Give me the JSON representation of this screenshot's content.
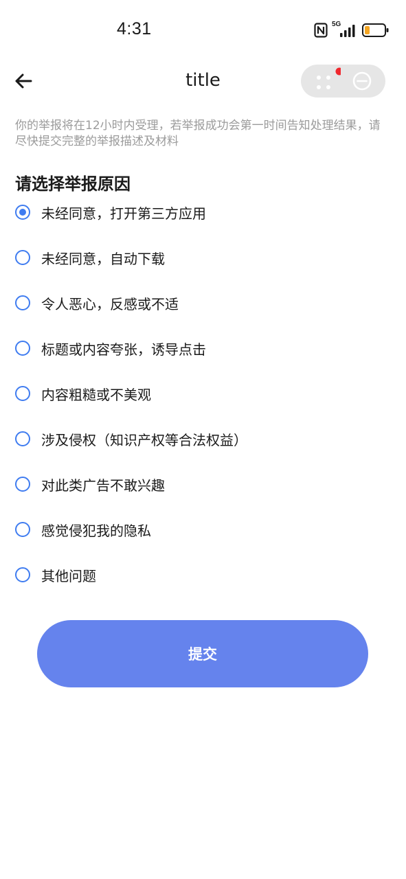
{
  "status_bar": {
    "time": "4:31",
    "network": "5G",
    "battery_color": "#f5a623"
  },
  "header": {
    "title": "title",
    "back_icon": "arrow-left-icon",
    "capsule": {
      "more_icon": "more-dots-icon",
      "close_icon": "minus-circle-icon",
      "badge_color": "#f0272d"
    }
  },
  "notice": "你的举报将在12小时内受理，若举报成功会第一时间告知处理结果，请尽快提交完整的举报描述及材料",
  "section_title": "请选择举报原因",
  "options": [
    {
      "label": "未经同意，打开第三方应用",
      "selected": true
    },
    {
      "label": "未经同意，自动下载",
      "selected": false
    },
    {
      "label": "令人恶心，反感或不适",
      "selected": false
    },
    {
      "label": "标题或内容夸张，诱导点击",
      "selected": false
    },
    {
      "label": "内容粗糙或不美观",
      "selected": false
    },
    {
      "label": "涉及侵权（知识产权等合法权益）",
      "selected": false
    },
    {
      "label": "对此类广告不敢兴趣",
      "selected": false
    },
    {
      "label": "感觉侵犯我的隐私",
      "selected": false
    },
    {
      "label": "其他问题",
      "selected": false
    }
  ],
  "submit_label": "提交",
  "colors": {
    "accent": "#3f7cf0",
    "button": "#6583ed",
    "notice_text": "#9b9b9b"
  }
}
